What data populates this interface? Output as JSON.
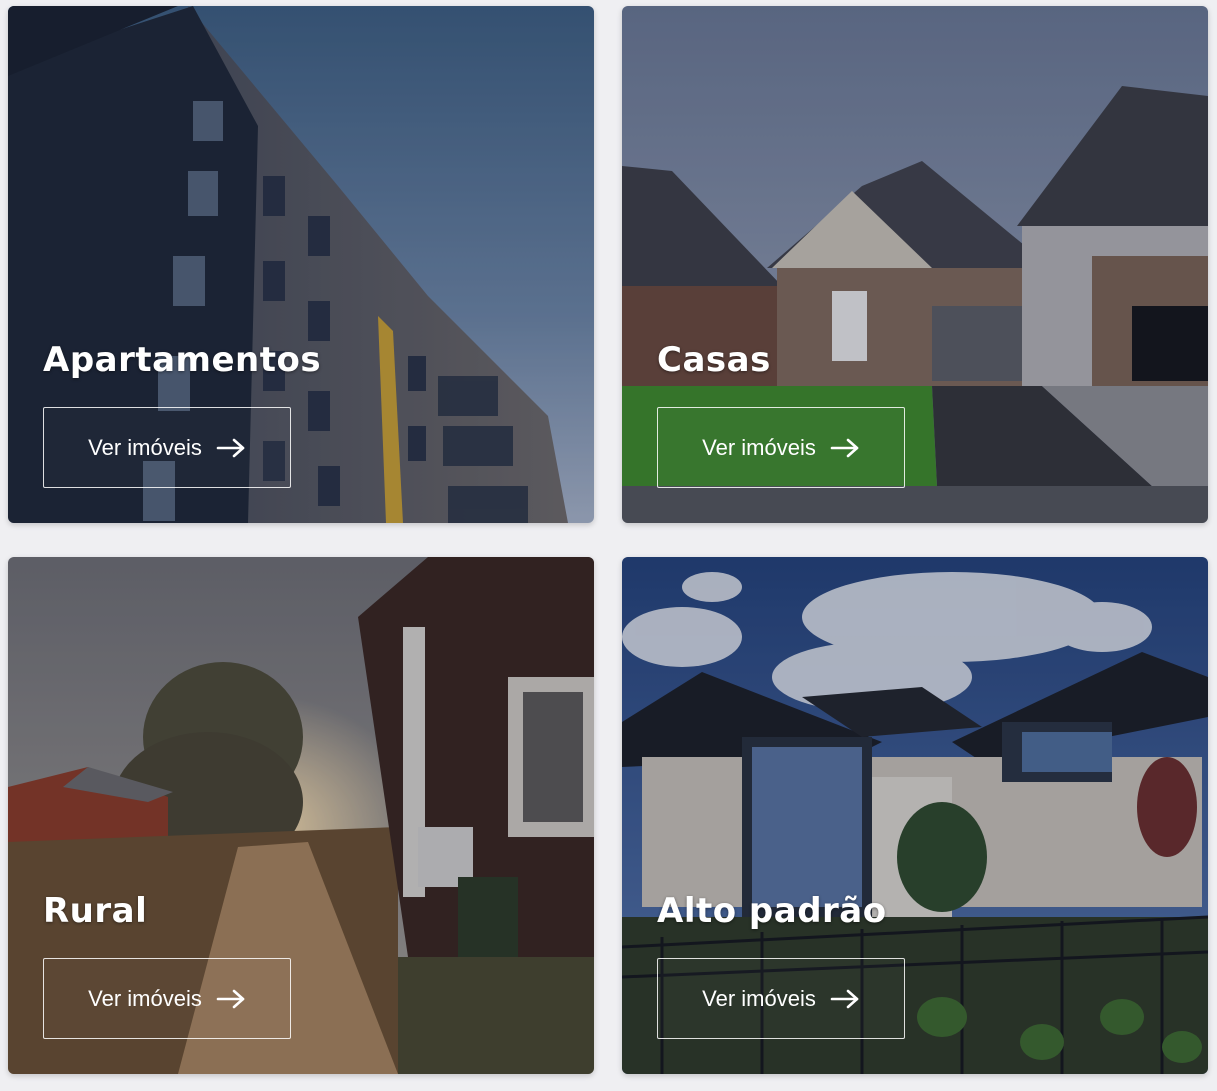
{
  "categories": [
    {
      "title": "Apartamentos",
      "button_label": "Ver imóveis",
      "image": "apartment-building-photo"
    },
    {
      "title": "Casas",
      "button_label": "Ver imóveis",
      "image": "suburban-houses-photo"
    },
    {
      "title": "Rural",
      "button_label": "Ver imóveis",
      "image": "countryside-road-photo"
    },
    {
      "title": "Alto padrão",
      "button_label": "Ver imóveis",
      "image": "luxury-modern-house-photo"
    }
  ],
  "icons": {
    "button_icon": "arrow-right-icon"
  },
  "colors": {
    "text": "#ffffff",
    "page_background": "#efeff2"
  }
}
